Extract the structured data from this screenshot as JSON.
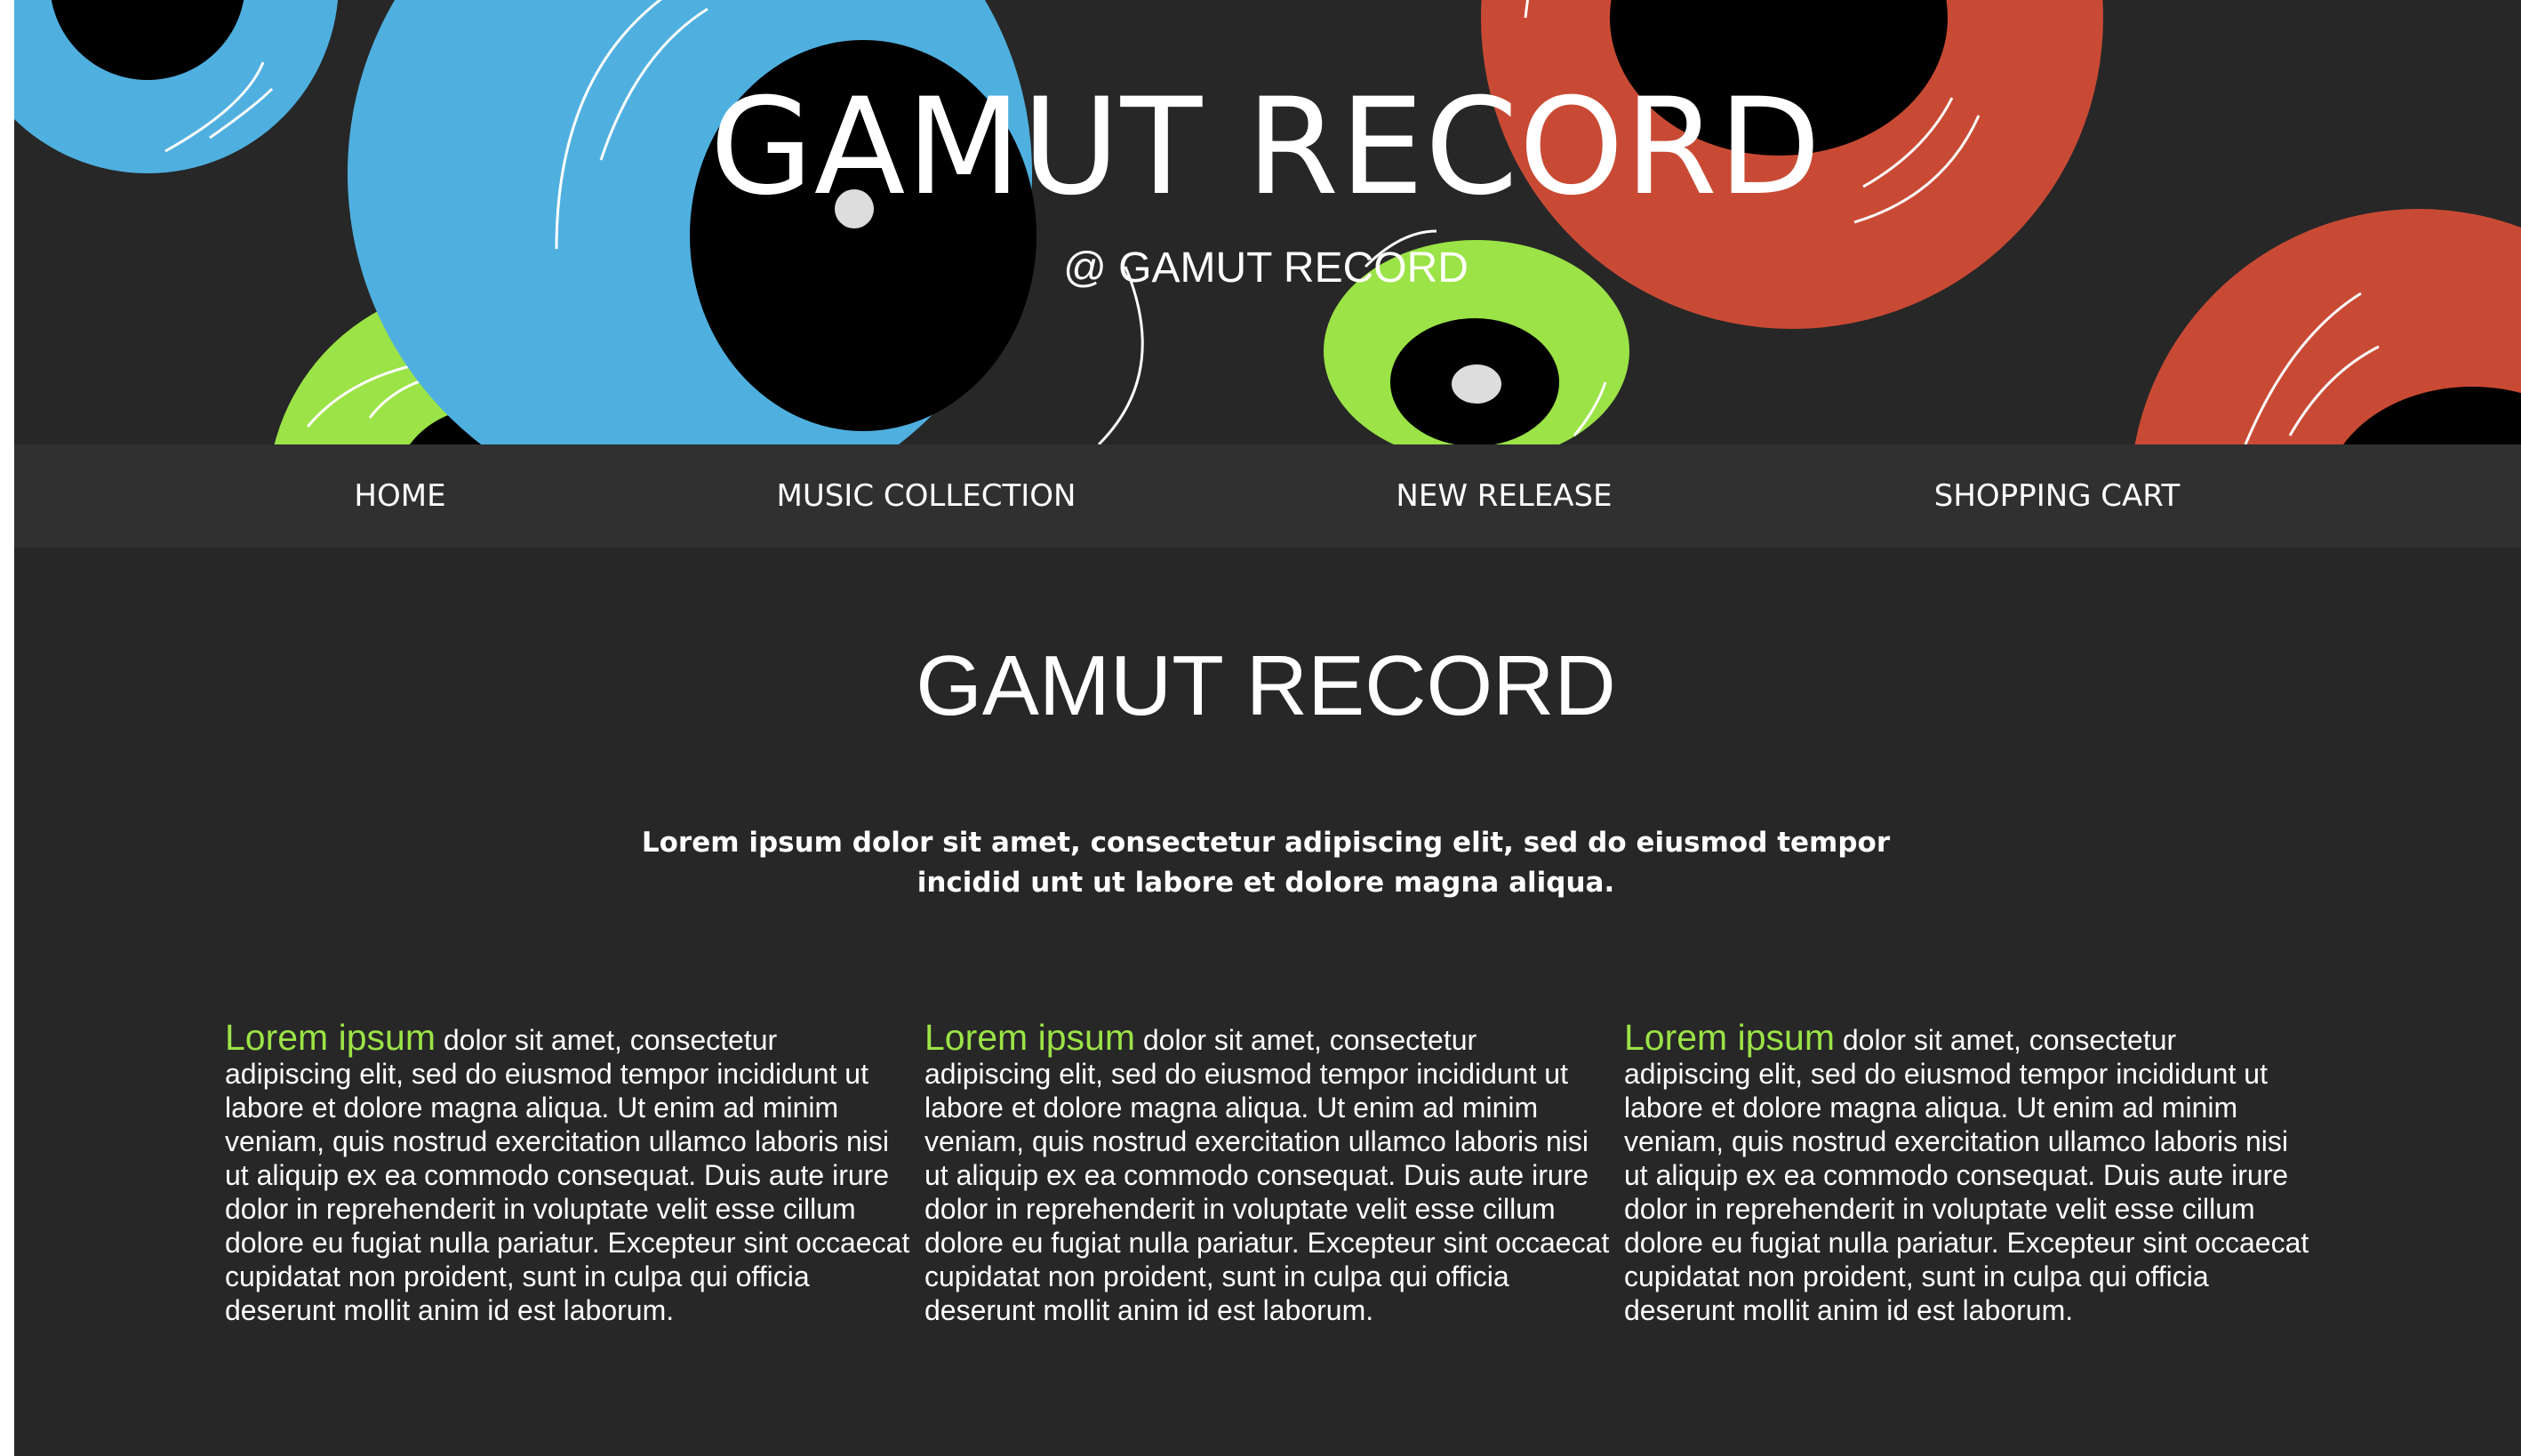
{
  "hero": {
    "title": "GAMUT RECORD",
    "subtitle": "@ GAMUT RECORD",
    "colors": {
      "background": "#272727",
      "blue_record": "#4fb0e0",
      "red_record": "#c94a34",
      "green_record": "#9be346",
      "record_center": "#000000"
    }
  },
  "nav": {
    "items": [
      {
        "label": "HOME"
      },
      {
        "label": "MUSIC COLLECTION"
      },
      {
        "label": "NEW RELEASE"
      },
      {
        "label": "SHOPPING CART"
      }
    ],
    "background": "#303030"
  },
  "main": {
    "title": "GAMUT RECORD",
    "intro": "Lorem ipsum dolor sit amet, consectetur adipiscing elit, sed do eiusmod tempor incidid unt ut labore et dolore magna aliqua.",
    "columns": [
      {
        "lead": "Lorem ipsum",
        "body": "dolor sit amet, consectetur adipiscing elit, sed do eiusmod tempor incididunt ut labore et dolore magna aliqua. Ut enim ad minim veniam, quis nostrud exercitation ullamco laboris nisi ut aliquip ex ea commodo consequat. Duis aute irure dolor in reprehenderit in voluptate velit esse cillum dolore eu fugiat nulla pariatur. Excepteur sint occaecat cupidatat non proident, sunt in culpa qui officia deserunt mollit anim id est laborum."
      },
      {
        "lead": "Lorem ipsum",
        "body": "dolor sit amet, consectetur adipiscing elit, sed do eiusmod tempor incididunt ut labore et dolore magna aliqua. Ut enim ad minim veniam, quis nostrud exercitation ullamco laboris nisi ut aliquip ex ea commodo consequat. Duis aute irure dolor in reprehenderit in voluptate velit esse cillum dolore eu fugiat nulla pariatur. Excepteur sint occaecat cupidatat non proident, sunt in culpa qui officia deserunt mollit anim id est laborum."
      },
      {
        "lead": "Lorem ipsum",
        "body": "dolor sit amet, consectetur adipiscing elit, sed do eiusmod tempor incididunt ut labore et dolore magna aliqua. Ut enim ad minim veniam, quis nostrud exercitation ullamco laboris nisi ut aliquip ex ea commodo consequat. Duis aute irure dolor in reprehenderit in voluptate velit esse cillum dolore eu fugiat nulla pariatur. Excepteur sint occaecat cupidatat non proident, sunt in culpa qui officia deserunt mollit anim id est laborum."
      }
    ],
    "accent_color": "#9be346"
  }
}
